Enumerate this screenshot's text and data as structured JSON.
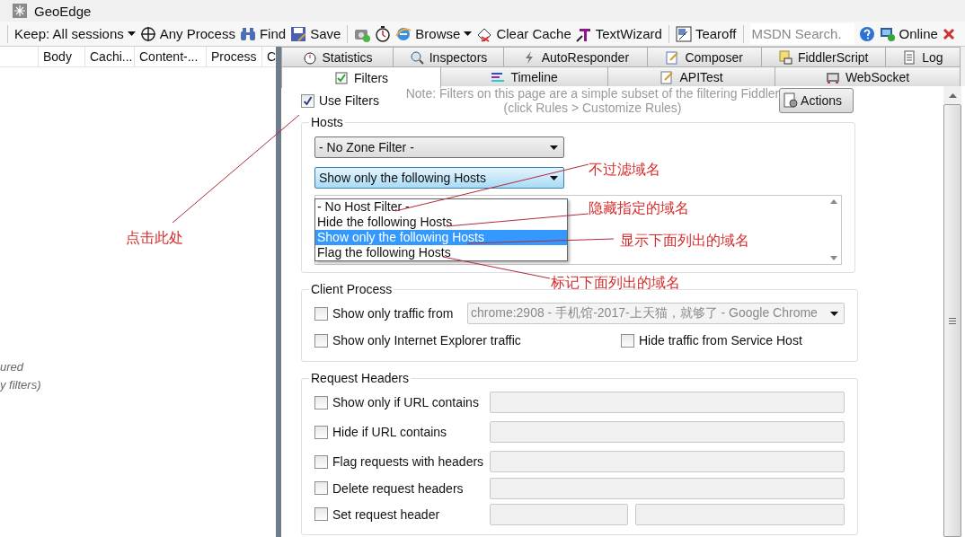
{
  "window": {
    "title": "GeoEdge"
  },
  "toolbar": [
    {
      "kind": "separator"
    },
    {
      "kind": "dropdown",
      "label": "Keep: All sessions"
    },
    {
      "kind": "button",
      "label": "Any Process"
    },
    {
      "kind": "button",
      "label": "Find"
    },
    {
      "kind": "button",
      "label": "Save"
    },
    {
      "kind": "separator"
    },
    {
      "kind": "icon"
    },
    {
      "kind": "icon"
    },
    {
      "kind": "dropdown",
      "label": "Browse"
    },
    {
      "kind": "button",
      "label": "Clear Cache"
    },
    {
      "kind": "button",
      "label": "TextWizard"
    },
    {
      "kind": "separator"
    },
    {
      "kind": "button",
      "label": "Tearoff"
    },
    {
      "kind": "separator"
    },
    {
      "kind": "search",
      "placeholder": "MSDN Search."
    },
    {
      "kind": "icon"
    },
    {
      "kind": "button",
      "label": "Online"
    },
    {
      "kind": "close"
    }
  ],
  "session_list": {
    "columns": [
      "Body",
      "Cachi...",
      "Content-...",
      "Process",
      "C"
    ],
    "message_lines": [
      "ured",
      "y filters)"
    ]
  },
  "tabs": [
    [
      {
        "label": "Statistics",
        "selected": false
      },
      {
        "label": "Inspectors",
        "selected": false
      },
      {
        "label": "AutoResponder",
        "selected": false
      },
      {
        "label": "Composer",
        "selected": false
      },
      {
        "label": "FiddlerScript",
        "selected": false
      },
      {
        "label": "Log",
        "selected": false
      }
    ],
    [
      {
        "label": "Filters",
        "selected": true
      },
      {
        "label": "Timeline",
        "selected": false
      },
      {
        "label": "APITest",
        "selected": false
      },
      {
        "label": "WebSocket",
        "selected": false
      }
    ]
  ],
  "filters": {
    "use_filters": {
      "label": "Use Filters",
      "checked": true
    },
    "note": [
      "Note: Filters on this page are a simple subset of the filtering Fiddler",
      "(click Rules > Customize Rules)"
    ],
    "actions_button": "Actions",
    "hosts": {
      "title": "Hosts",
      "zone_filter": "- No Zone Filter -",
      "host_filter": "Show only the following Hosts",
      "open": true,
      "host_options": [
        {
          "label": "- No Host Filter -",
          "selected": false
        },
        {
          "label": "Hide the following Hosts",
          "selected": false
        },
        {
          "label": "Show only the following Hosts",
          "selected": true
        },
        {
          "label": "Flag the following Hosts",
          "selected": false
        }
      ]
    },
    "client_process": {
      "title": "Client Process",
      "traffic_from": {
        "label": "Show only traffic from",
        "checked": false,
        "process": "chrome:2908 - 手机馆-2017-上天猫，就够了 - Google Chrome",
        "disabled": true
      },
      "ie_only": {
        "label": "Show only Internet Explorer traffic",
        "checked": false
      },
      "hide_service_host": {
        "label": "Hide traffic from Service Host",
        "checked": false
      }
    },
    "request_headers": {
      "title": "Request Headers",
      "rows": [
        {
          "kind": "single",
          "label": "Show only if URL contains",
          "checked": false
        },
        {
          "kind": "single",
          "label": "Hide if URL contains",
          "checked": false
        },
        {
          "kind": "single",
          "label": "Flag requests with headers",
          "checked": false
        },
        {
          "kind": "single",
          "label": "Delete request headers",
          "checked": false
        },
        {
          "kind": "pair",
          "label": "Set request header",
          "checked": false
        }
      ]
    }
  },
  "annotations": [
    {
      "text": "点击此处"
    },
    {
      "text": "不过滤域名"
    },
    {
      "text": "隐藏指定的域名"
    },
    {
      "text": "显示下面列出的域名"
    },
    {
      "text": "标记下面列出的域名"
    }
  ]
}
